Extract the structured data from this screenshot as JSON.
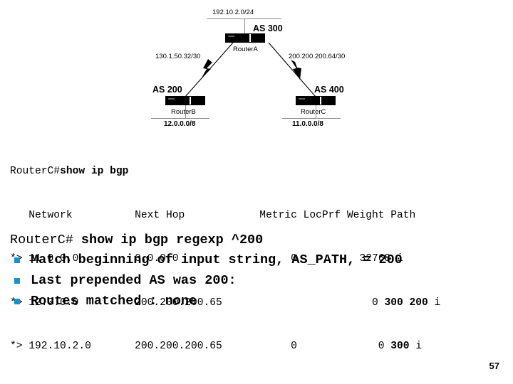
{
  "diagram": {
    "top_network": "192.10.2.0/24",
    "as_top": "AS 300",
    "router_top": "RouterA",
    "left_link": "130.1.50.32/30",
    "right_link": "200.200.200.64/30",
    "as_left": "AS 200",
    "router_left": "RouterB",
    "stub_left": "12.0.0.0/8",
    "as_right": "AS 400",
    "router_right": "RouterC",
    "stub_right": "11.0.0.0/8"
  },
  "terminal": {
    "prompt": "RouterC#",
    "command": "show ip bgp",
    "header": "   Network          Next Hop            Metric LocPrf Weight Path",
    "rows": [
      {
        "prefix": "*> 11.0.0.0         0.0.0.0                  0          32768 ",
        "path_bold": "",
        "path_tail": "i"
      },
      {
        "prefix": "*> 12.0.0.0         200.200.200.65                        0 ",
        "path_bold": "300 200",
        "path_tail": " i"
      },
      {
        "prefix": "*> 192.10.2.0       200.200.200.65           0             0 ",
        "path_bold": "300",
        "path_tail": " i"
      }
    ]
  },
  "lower": {
    "prompt2": "RouterC# ",
    "command2": "show ip bgp regexp ^200",
    "bullets": [
      "Match beginning of input string, AS_PATH, = 200",
      "Last prepended AS was 200:",
      "Routes matched : none"
    ]
  },
  "footer": {
    "page_number": "57"
  },
  "colors": {
    "bullet": "#1792cd",
    "text": "#000000",
    "line": "#8a8a8a",
    "background": "#ffffff"
  }
}
